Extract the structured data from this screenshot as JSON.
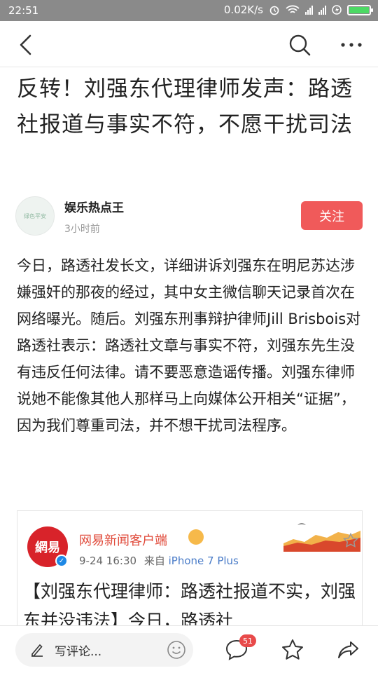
{
  "status_bar": {
    "time": "22:51",
    "network_speed": "0.02K/s",
    "icons": [
      "alarm-icon",
      "wifi-icon",
      "signal-icon",
      "signal-icon",
      "charging-icon"
    ],
    "battery_level": 1.0,
    "battery_color": "#4cd964"
  },
  "nav": {
    "icons": [
      "back-icon",
      "search-icon",
      "more-icon"
    ]
  },
  "article": {
    "title": "反转！刘强东代理律师发声：路透社报道与事实不符，不愿干扰司法",
    "author": {
      "name": "娱乐热点王",
      "time": "3小时前",
      "avatar_text": "绿色平安"
    },
    "follow_label": "关注",
    "body": "今日，路透社发长文，详细讲诉刘强东在明尼苏达涉嫌强奸的那夜的经过，其中女主微信聊天记录首次在网络曝光。随后。刘强东刑事辩护律师Jill Brisbois对路透社表示：路透社文章与事实不符，刘强东先生没有违反任何法律。请不要恶意造谣传播。刘强东律师说她不能像其他人那样马上向媒体公开相关“证据”，因为我们尊重司法，并不想干扰司法程序。",
    "embed": {
      "logo_text": "網易",
      "source_name": "网易新闻客户端",
      "date": "9-24 16:30",
      "via_prefix": "来自",
      "via_app": "iPhone 7 Plus",
      "quote": "【刘强东代理律师：路透社报道不实，刘强东并没违法】今日，路透社"
    }
  },
  "bottom_bar": {
    "comment_placeholder": "写评论...",
    "comment_count": "51",
    "icons": [
      "pen-icon",
      "emoji-icon",
      "comment-icon",
      "star-icon",
      "share-icon"
    ],
    "accent_color": "#f05a5a"
  }
}
